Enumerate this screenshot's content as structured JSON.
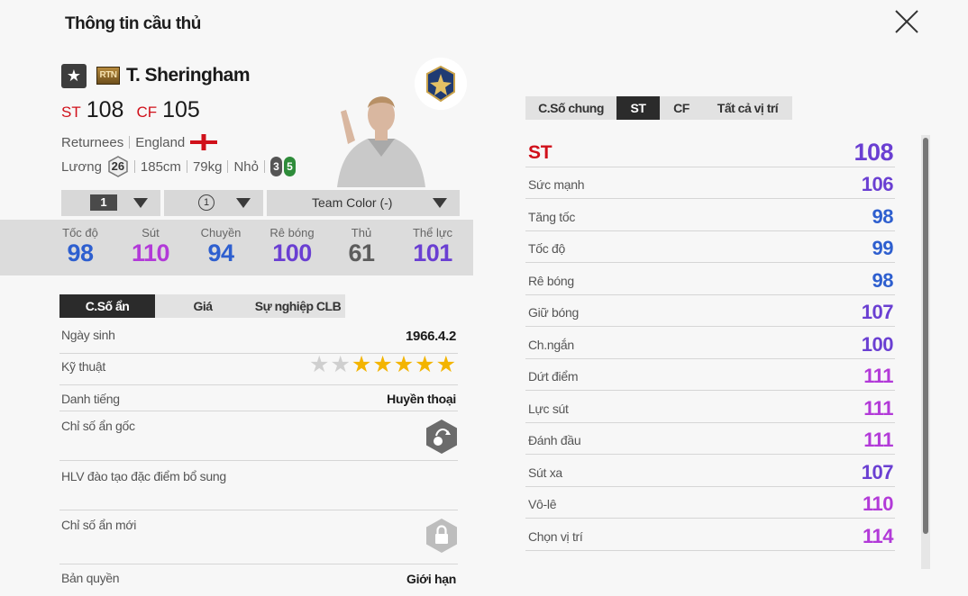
{
  "window": {
    "title": "Thông tin cầu thủ"
  },
  "player": {
    "season_badge": "RTN",
    "name": "T. Sheringham",
    "positions": [
      {
        "pos": "ST",
        "ovr": "108"
      },
      {
        "pos": "CF",
        "ovr": "105"
      }
    ],
    "season": "Returnees",
    "nation": "England",
    "salary_label": "Lương",
    "salary": "26",
    "height": "185cm",
    "weight": "79kg",
    "body_type": "Nhỏ",
    "weak_foot": "3",
    "strong_foot": "5"
  },
  "dropdowns": {
    "level": "1",
    "upgrade": "1",
    "team_color": "Team Color (-)"
  },
  "summary": [
    {
      "label": "Tốc độ",
      "value": "98",
      "color": "#2e5fcf"
    },
    {
      "label": "Sút",
      "value": "110",
      "color": "#b23ad8"
    },
    {
      "label": "Chuyền",
      "value": "94",
      "color": "#2e5fcf"
    },
    {
      "label": "Rê bóng",
      "value": "100",
      "color": "#6a3fd2"
    },
    {
      "label": "Thủ",
      "value": "61",
      "color": "#5c5c5c"
    },
    {
      "label": "Thể lực",
      "value": "101",
      "color": "#6a3fd2"
    }
  ],
  "left_tabs": [
    "C.Số ẩn",
    "Giá",
    "Sự nghiệp CLB"
  ],
  "details": {
    "birth_label": "Ngày sinh",
    "birth": "1966.4.2",
    "skill_label": "Kỹ thuật",
    "skill_stars": 5,
    "reputation_label": "Danh tiếng",
    "reputation": "Huyền thoại",
    "orig_traits_label": "Chỉ số ẩn gốc",
    "coach_label": "HLV đào tạo đặc điểm bổ sung",
    "new_traits_label": "Chỉ số ẩn mới",
    "license_label": "Bản quyền",
    "license": "Giới hạn"
  },
  "right_tabs": [
    "C.Số chung",
    "ST",
    "CF",
    "Tất cả vị trí"
  ],
  "position_stats": {
    "pos": "ST",
    "ovr": "108",
    "ovr_color": "#6a3fd2",
    "rows": [
      {
        "label": "Sức mạnh",
        "value": "106",
        "color": "#6a3fd2"
      },
      {
        "label": "Tăng tốc",
        "value": "98",
        "color": "#2e5fcf"
      },
      {
        "label": "Tốc độ",
        "value": "99",
        "color": "#2e5fcf"
      },
      {
        "label": "Rê bóng",
        "value": "98",
        "color": "#2e5fcf"
      },
      {
        "label": "Giữ bóng",
        "value": "107",
        "color": "#6a3fd2"
      },
      {
        "label": "Ch.ngắn",
        "value": "100",
        "color": "#6a3fd2"
      },
      {
        "label": "Dứt điểm",
        "value": "111",
        "color": "#b23ad8"
      },
      {
        "label": "Lực sút",
        "value": "111",
        "color": "#b23ad8"
      },
      {
        "label": "Đánh đầu",
        "value": "111",
        "color": "#b23ad8"
      },
      {
        "label": "Sút xa",
        "value": "107",
        "color": "#6a3fd2"
      },
      {
        "label": "Vô-lê",
        "value": "110",
        "color": "#b23ad8"
      },
      {
        "label": "Chọn vị trí",
        "value": "114",
        "color": "#b23ad8"
      }
    ]
  }
}
